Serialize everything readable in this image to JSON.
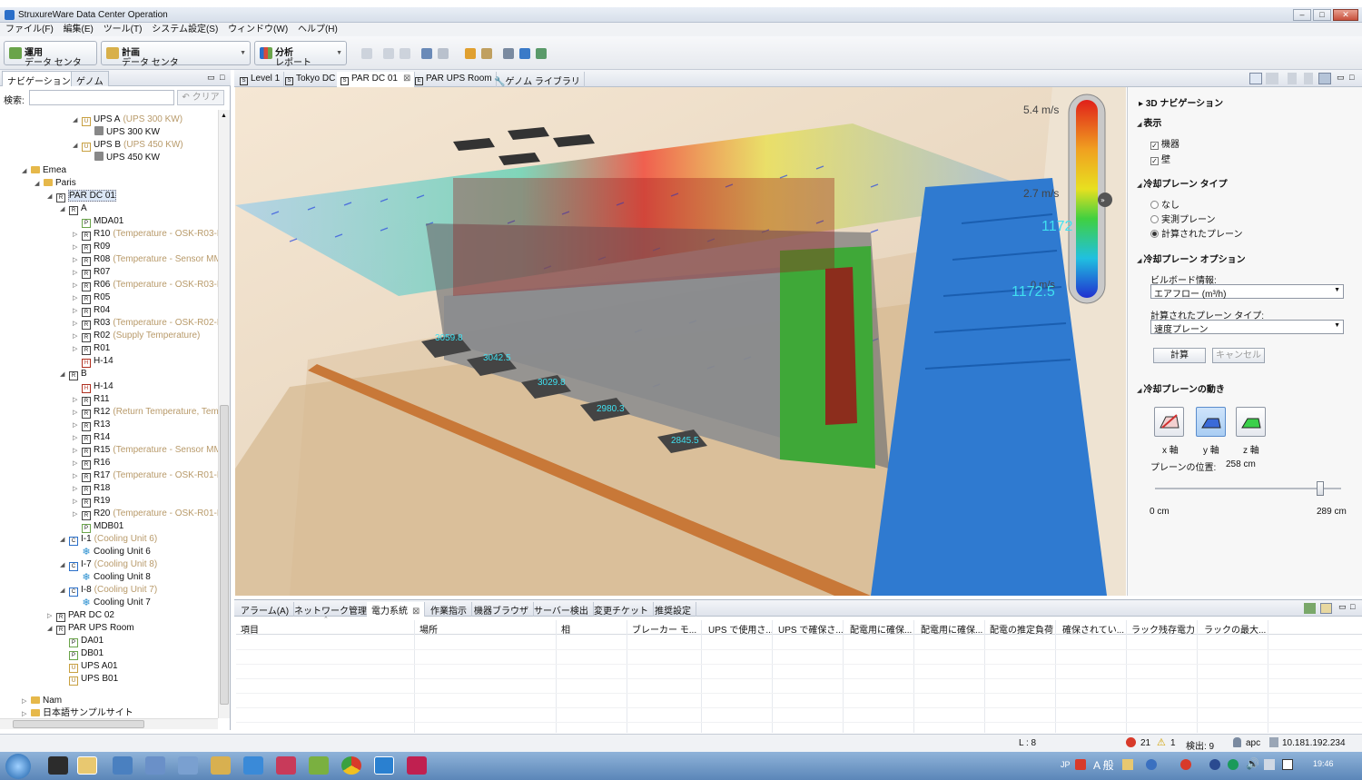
{
  "window": {
    "title": "StruxureWare Data Center Operation"
  },
  "menu": [
    "ファイル(F)",
    "編集(E)",
    "ツール(T)",
    "システム設定(S)",
    "ウィンドウ(W)",
    "ヘルプ(H)"
  ],
  "perspectives": [
    {
      "title": "運用",
      "sub": "データ センタ"
    },
    {
      "title": "計画",
      "sub": "データ センタ"
    },
    {
      "title": "分析",
      "sub": "レポート"
    }
  ],
  "left_tabs": [
    "ナビゲーション",
    "ゲノム"
  ],
  "search": {
    "label": "検索:",
    "value": "",
    "clear": "クリア"
  },
  "tree": [
    {
      "name": "UPS A",
      "extra": "(UPS 300 KW)",
      "icon": "ups"
    },
    {
      "name": "UPS 300 KW",
      "extra": "",
      "icon": "srv"
    },
    {
      "name": "UPS B",
      "extra": "(UPS 450 KW)",
      "icon": "ups"
    },
    {
      "name": "UPS 450 KW",
      "extra": "",
      "icon": "srv"
    },
    {
      "name": "Emea",
      "extra": "",
      "icon": "fold"
    },
    {
      "name": "Paris",
      "extra": "",
      "icon": "fold"
    },
    {
      "name": "PAR DC 01",
      "extra": "",
      "icon": "r"
    },
    {
      "name": "A",
      "extra": "",
      "icon": "r"
    },
    {
      "name": "MDA01",
      "extra": "",
      "icon": "p"
    },
    {
      "name": "R10",
      "extra": "(Temperature - OSK-R03-F",
      "icon": "r"
    },
    {
      "name": "R09",
      "extra": "",
      "icon": "r"
    },
    {
      "name": "R08",
      "extra": "(Temperature - Sensor MM",
      "icon": "r"
    },
    {
      "name": "R07",
      "extra": "",
      "icon": "r"
    },
    {
      "name": "R06",
      "extra": "(Temperature - OSK-R03-R",
      "icon": "r"
    },
    {
      "name": "R05",
      "extra": "",
      "icon": "r"
    },
    {
      "name": "R04",
      "extra": "",
      "icon": "r"
    },
    {
      "name": "R03",
      "extra": "(Temperature - OSK-R02-R",
      "icon": "r"
    },
    {
      "name": "R02",
      "extra": "(Supply Temperature)",
      "icon": "r"
    },
    {
      "name": "R01",
      "extra": "",
      "icon": "r"
    },
    {
      "name": "H-14",
      "extra": "",
      "icon": "h"
    },
    {
      "name": "B",
      "extra": "",
      "icon": "r"
    },
    {
      "name": "H-14",
      "extra": "",
      "icon": "h"
    },
    {
      "name": "R11",
      "extra": "",
      "icon": "r"
    },
    {
      "name": "R12",
      "extra": "(Return Temperature, Tem",
      "icon": "r"
    },
    {
      "name": "R13",
      "extra": "",
      "icon": "r"
    },
    {
      "name": "R14",
      "extra": "",
      "icon": "r"
    },
    {
      "name": "R15",
      "extra": "(Temperature - Sensor MM",
      "icon": "r"
    },
    {
      "name": "R16",
      "extra": "",
      "icon": "r"
    },
    {
      "name": "R17",
      "extra": "(Temperature - OSK-R01-R",
      "icon": "r"
    },
    {
      "name": "R18",
      "extra": "",
      "icon": "r"
    },
    {
      "name": "R19",
      "extra": "",
      "icon": "r"
    },
    {
      "name": "R20",
      "extra": "(Temperature - OSK-R01-F",
      "icon": "r"
    },
    {
      "name": "MDB01",
      "extra": "",
      "icon": "p"
    },
    {
      "name": "I-1",
      "extra": "(Cooling Unit 6)",
      "icon": "c"
    },
    {
      "name": "Cooling Unit 6",
      "extra": "",
      "icon": "cool"
    },
    {
      "name": "I-7",
      "extra": "(Cooling Unit 8)",
      "icon": "c"
    },
    {
      "name": "Cooling Unit 8",
      "extra": "",
      "icon": "cool"
    },
    {
      "name": "I-8",
      "extra": "(Cooling Unit 7)",
      "icon": "c"
    },
    {
      "name": "Cooling Unit 7",
      "extra": "",
      "icon": "cool"
    },
    {
      "name": "PAR DC 02",
      "extra": "",
      "icon": "r"
    },
    {
      "name": "PAR UPS Room",
      "extra": "",
      "icon": "r"
    },
    {
      "name": "DA01",
      "extra": "",
      "icon": "p"
    },
    {
      "name": "DB01",
      "extra": "",
      "icon": "p"
    },
    {
      "name": "UPS A01",
      "extra": "",
      "icon": "ups"
    },
    {
      "name": "UPS B01",
      "extra": "",
      "icon": "ups"
    },
    {
      "name": "Nam",
      "extra": "",
      "icon": "fold"
    },
    {
      "name": "日本語サンプルサイト",
      "extra": "",
      "icon": "fold"
    }
  ],
  "editor_tabs": [
    "Level 1",
    "Tokyo DC",
    "PAR DC 01",
    "PAR UPS Room",
    "ゲノム ライブラリ"
  ],
  "scene": {
    "legend_max": "5.4 m/s",
    "legend_mid": "2.7 m/s",
    "legend_min": "0 m/s",
    "tile_labels": [
      "3059.8",
      "3042.5",
      "3029.8",
      "2980.3",
      "2845.5"
    ],
    "room_labels": [
      "1172",
      "1172.5"
    ]
  },
  "right_panel": {
    "nav3d": "3D ナビゲーション",
    "display": "表示",
    "display_items": [
      "機器",
      "壁"
    ],
    "plane_type": "冷却プレーン タイプ",
    "plane_type_options": [
      "なし",
      "実測プレーン",
      "計算されたプレーン"
    ],
    "plane_options": "冷却プレーン オプション",
    "billboard_label": "ビルボード情報:",
    "billboard_value": "エアフロー (m³/h)",
    "calc_plane_label": "計算されたプレーン タイプ:",
    "calc_plane_value": "速度プレーン",
    "calc_button": "計算",
    "cancel_button": "キャンセル",
    "plane_motion": "冷却プレーンの動き",
    "axes": [
      "x 軸",
      "y 軸",
      "z 軸"
    ],
    "plane_position_label": "プレーンの位置:",
    "plane_position_value": "258 cm",
    "slider_min": "0 cm",
    "slider_max": "289 cm",
    "slider_fraction": 0.89
  },
  "bottom_tabs": [
    "アラーム(A)",
    "ネットワーク管理",
    "電力系統",
    "作業指示",
    "機器ブラウザ",
    "サーバー検出",
    "変更チケット",
    "推奨設定"
  ],
  "table_headers": [
    "項目",
    "場所",
    "相",
    "ブレーカー モ...",
    "UPS で使用さ...",
    "UPS で確保さ...",
    "配電用に確保...",
    "配電用に確保...",
    "配電の推定負荷",
    "確保されてい...",
    "ラック残存電力",
    "ラックの最大..."
  ],
  "status": {
    "l": "L : 8",
    "errors": "21",
    "warnings": "1",
    "detect": "検出: 9",
    "user": "apc",
    "ip": "10.181.192.234"
  },
  "taskbar": {
    "lang": "JP",
    "ime": "A 般",
    "time": "19:46"
  }
}
